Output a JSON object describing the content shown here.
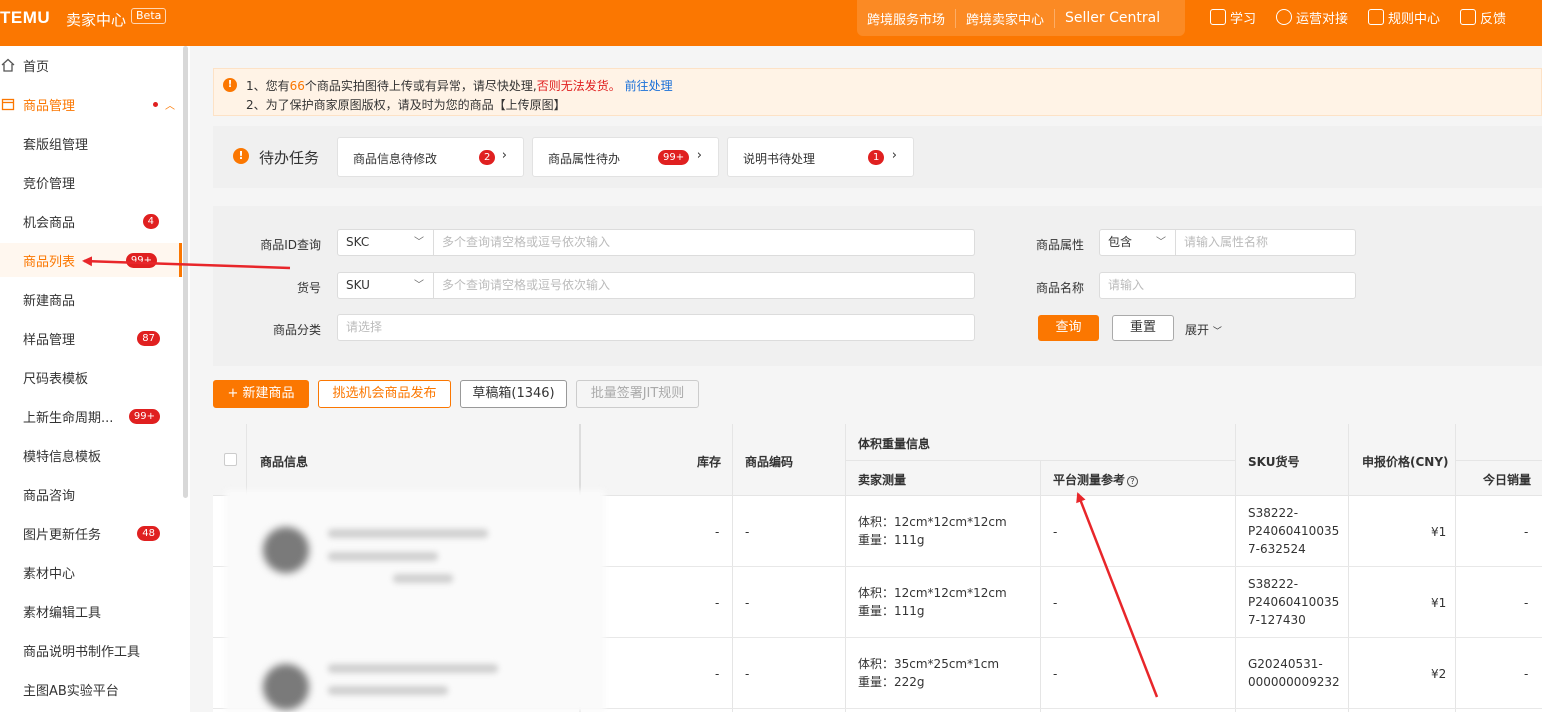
{
  "header": {
    "logo": "TEMU",
    "logo_sub": "卖家中心",
    "beta": "Beta",
    "nav": [
      "跨境服务市场",
      "跨境卖家中心",
      "Seller Central"
    ],
    "right": [
      {
        "icon": "book-icon",
        "label": "学习"
      },
      {
        "icon": "chat-icon",
        "label": "运营对接"
      },
      {
        "icon": "rules-icon",
        "label": "规则中心"
      },
      {
        "icon": "feedback-icon",
        "label": "反馈"
      }
    ]
  },
  "sidebar": {
    "items": [
      {
        "label": "首页",
        "icon": "home-icon"
      },
      {
        "label": "商品管理",
        "icon": "product-icon"
      },
      {
        "label": "套版组管理"
      },
      {
        "label": "竞价管理"
      },
      {
        "label": "机会商品",
        "badge": "4"
      },
      {
        "label": "商品列表",
        "badge": "99+"
      },
      {
        "label": "新建商品"
      },
      {
        "label": "样品管理",
        "badge": "87"
      },
      {
        "label": "尺码表模板"
      },
      {
        "label": "上新生命周期...",
        "badge": "99+"
      },
      {
        "label": "模特信息模板"
      },
      {
        "label": "商品咨询"
      },
      {
        "label": "图片更新任务",
        "badge": "48"
      },
      {
        "label": "素材中心"
      },
      {
        "label": "素材编辑工具"
      },
      {
        "label": "商品说明书制作工具"
      },
      {
        "label": "主图AB实验平台"
      }
    ]
  },
  "notice": {
    "l1_a": "1、您有",
    "l1_count": "66",
    "l1_b": "个商品实拍图待上传或有异常，请尽快处理,",
    "l1_warn": "否则无法发货。",
    "l1_link": "前往处理",
    "l2": "2、为了保护商家原图版权，请及时为您的商品【上传原图】"
  },
  "todo": {
    "title": "待办任务",
    "cards": [
      {
        "label": "商品信息待修改",
        "badge": "2"
      },
      {
        "label": "商品属性待办",
        "badge": "99+"
      },
      {
        "label": "说明书待处理",
        "badge": "1"
      }
    ]
  },
  "filter": {
    "product_id_label": "商品ID查询",
    "product_id_type": "SKC",
    "product_id_placeholder": "多个查询请空格或逗号依次输入",
    "sku_label": "货号",
    "sku_type": "SKU",
    "sku_placeholder": "多个查询请空格或逗号依次输入",
    "category_label": "商品分类",
    "category_placeholder": "请选择",
    "attr_label": "商品属性",
    "attr_type": "包含",
    "attr_placeholder": "请输入属性名称",
    "name_label": "商品名称",
    "name_placeholder": "请输入",
    "query": "查询",
    "reset": "重置",
    "expand": "展开"
  },
  "actions": {
    "new_product": "+ 新建商品",
    "pick_opportunity": "挑选机会商品发布",
    "drafts": "草稿箱(1346)",
    "batch_sign": "批量签署JIT规则"
  },
  "table": {
    "headers": {
      "product_info": "商品信息",
      "stock": "库存",
      "product_code": "商品编码",
      "volume_weight": "体积重量信息",
      "seller_measure": "卖家测量",
      "platform_measure": "平台测量参考",
      "sku_no": "SKU货号",
      "price": "申报价格(CNY)",
      "today_sales": "今日销量"
    },
    "rows": [
      {
        "stock": "-",
        "code": "-",
        "volume": "体积：12cm*12cm*12cm",
        "weight": "重量：111g",
        "platform": "-",
        "sku": [
          "S38222-",
          "P24060410035",
          "7-632524"
        ],
        "price": "¥1",
        "sales": "-"
      },
      {
        "stock": "-",
        "code": "-",
        "volume": "体积：12cm*12cm*12cm",
        "weight": "重量：111g",
        "platform": "-",
        "sku": [
          "S38222-",
          "P24060410035",
          "7-127430"
        ],
        "price": "¥1",
        "sales": "-"
      },
      {
        "stock": "-",
        "code": "-",
        "volume": "体积：35cm*25cm*1cm",
        "weight": "重量：222g",
        "platform": "-",
        "sku": [
          "G20240531-",
          "000000009232"
        ],
        "price": "¥2",
        "sales": "-"
      }
    ]
  },
  "colors": {
    "brand": "#fb7701",
    "badge": "#e02020",
    "annotation_arrow": "#e8262a"
  }
}
